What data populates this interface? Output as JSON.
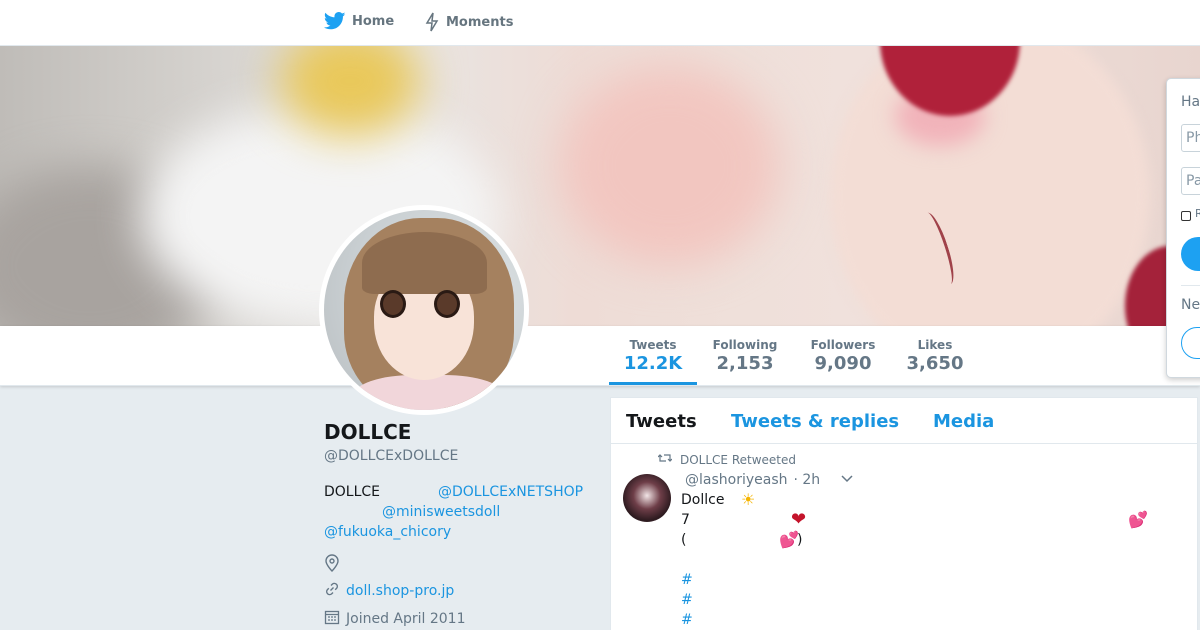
{
  "nav": {
    "home_label": "Home",
    "moments_label": "Moments"
  },
  "profile": {
    "name": "DOLLCE",
    "handle": "@DOLLCExDOLLCE",
    "bio_line1_text": "DOLLCE",
    "bio_mention1": "@DOLLCExNETSHOP",
    "bio_mention2": "@minisweetsdoll",
    "bio_mention3": "@fukuoka_chicory",
    "location": "",
    "website": "doll.shop-pro.jp",
    "joined": "Joined April 2011"
  },
  "stats": [
    {
      "label": "Tweets",
      "value": "12.2K"
    },
    {
      "label": "Following",
      "value": "2,153"
    },
    {
      "label": "Followers",
      "value": "9,090"
    },
    {
      "label": "Likes",
      "value": "3,650"
    }
  ],
  "tabs": {
    "tweets": "Tweets",
    "replies": "Tweets & replies",
    "media": "Media"
  },
  "tweet": {
    "retweet_context": "DOLLCE Retweeted",
    "handle": "@lashoriyeash",
    "time": "· 2h",
    "line1": "Dollce",
    "line2": "7",
    "line3_open": "(",
    "line3_close": ")",
    "hash1": "#",
    "hash2": "#",
    "hash3": "#"
  },
  "login": {
    "title": "Ha",
    "phone_placeholder": "Ph",
    "password_placeholder": "Pa",
    "remember": "R",
    "new_label": "Ne"
  },
  "colors": {
    "accent": "#1b95e0",
    "background": "#e6ecf0",
    "heart": "#c4142b"
  },
  "icons": {
    "home": "bird-icon",
    "moments": "lightning-icon",
    "location": "location-pin-icon",
    "website": "link-icon",
    "joined": "calendar-icon",
    "retweet": "retweet-icon",
    "caret": "chevron-down-icon"
  }
}
